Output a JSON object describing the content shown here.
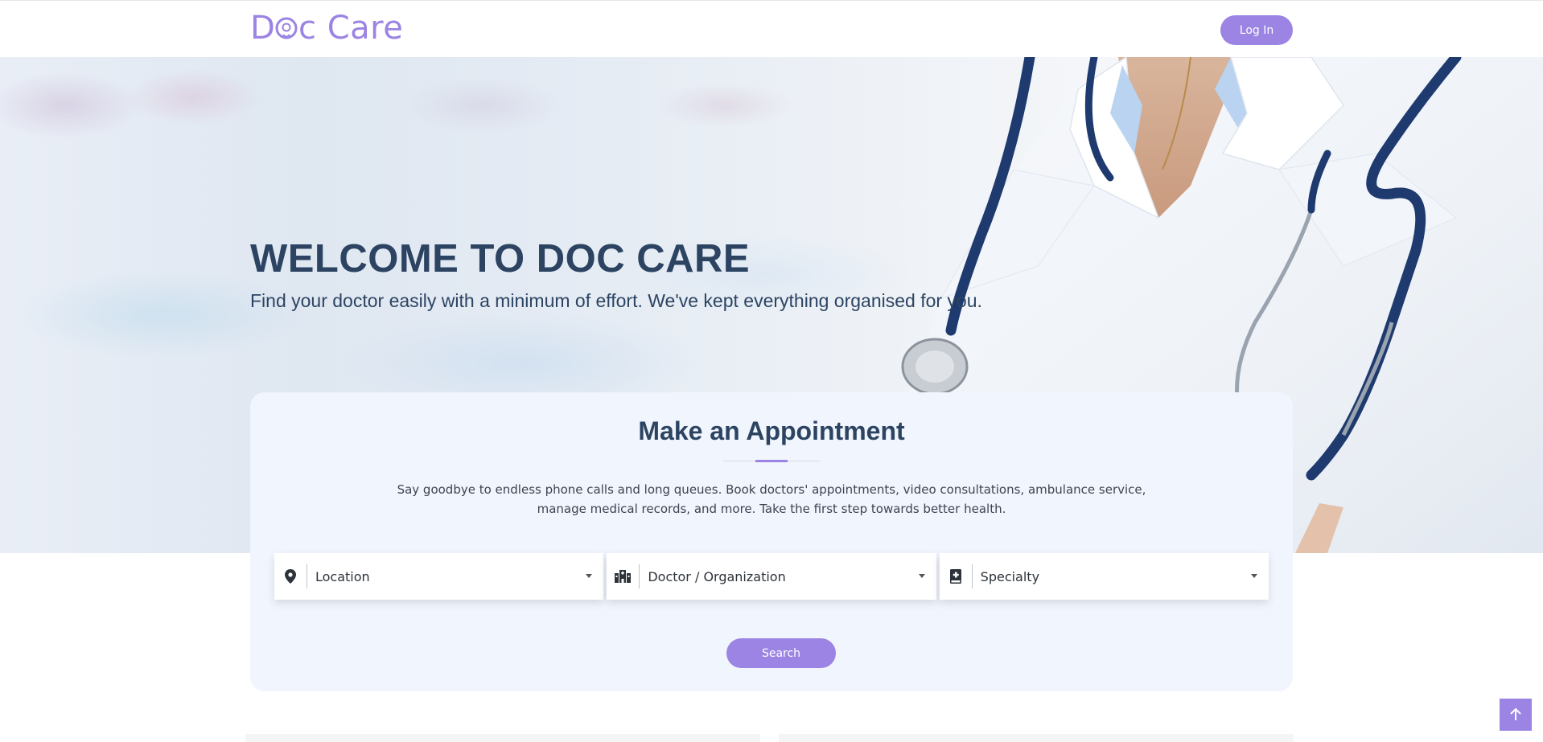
{
  "header": {
    "logo_text": "Doc Care",
    "login_label": "Log In"
  },
  "hero": {
    "title": "WELCOME TO DOC CARE",
    "subtitle": "Find your doctor easily with a minimum of effort. We've kept everything organised for you."
  },
  "appointment": {
    "title": "Make an Appointment",
    "description_line1": "Say goodbye to endless phone calls and long queues. Book doctors' appointments, video consultations, ambulance service,",
    "description_line2": "manage medical records, and more. Take the first step towards better health.",
    "selects": [
      {
        "label": "Location",
        "icon": "location-pin-icon"
      },
      {
        "label": "Doctor / Organization",
        "icon": "hospital-building-icon"
      },
      {
        "label": "Specialty",
        "icon": "medical-book-icon"
      }
    ],
    "search_label": "Search"
  },
  "scroll_top": {
    "icon": "arrow-up-icon"
  },
  "colors": {
    "accent": "#9b84e3",
    "heading": "#2c4462",
    "card_bg": "#f1f5fd"
  }
}
